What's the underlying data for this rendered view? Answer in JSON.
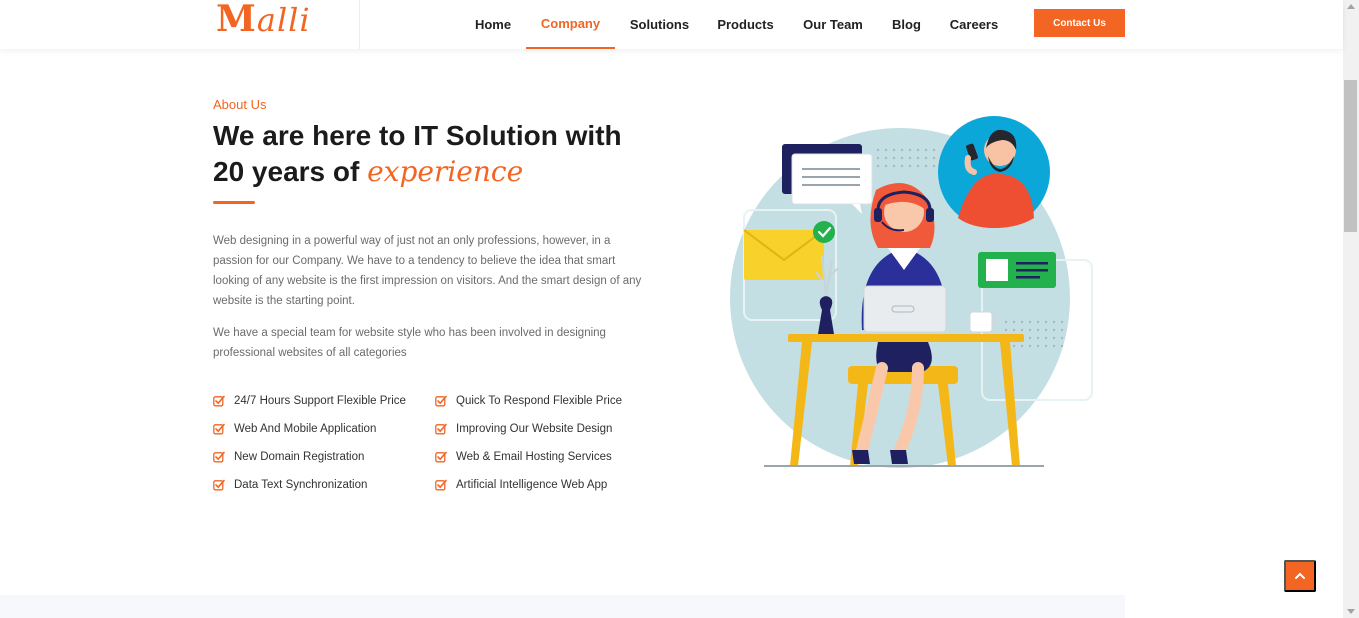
{
  "brand": {
    "logo_text": "Malli",
    "logo_first": "M",
    "logo_rest": "alli",
    "accent": "#f26522"
  },
  "nav": {
    "items": [
      {
        "label": "Home",
        "active": false
      },
      {
        "label": "Company",
        "active": true
      },
      {
        "label": "Solutions",
        "active": false
      },
      {
        "label": "Products",
        "active": false
      },
      {
        "label": "Our Team",
        "active": false
      },
      {
        "label": "Blog",
        "active": false
      },
      {
        "label": "Careers",
        "active": false
      }
    ],
    "contact_label": "Contact Us"
  },
  "about": {
    "eyebrow": "About Us",
    "headline_line1": "We are here to IT Solution with",
    "headline_line2_prefix": "20 years of ",
    "headline_accent": "experience",
    "paragraph1": "Web designing in a powerful way of just not an only professions, however, in a passion for our Company. We have to a tendency to believe the idea that smart looking of any website is the first impression on visitors. And the smart design of any website is the starting point.",
    "paragraph2": "We have a special team for website style who has been involved in designing professional websites of all categories",
    "features": [
      "24/7 Hours Support Flexible Price",
      "Quick To Respond Flexible Price",
      "Web And Mobile Application",
      "Improving Our Website Design",
      "New Domain Registration",
      "Web & Email Hosting Services",
      "Data Text Synchronization",
      "Artificial Intelligence Web App"
    ]
  },
  "icons": {
    "check": "check-square-icon",
    "scroll_top": "chevron-up-icon"
  }
}
